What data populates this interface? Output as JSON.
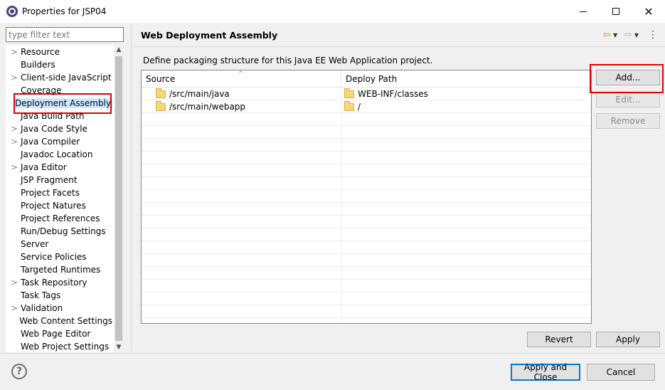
{
  "window": {
    "title": "Properties for JSP04",
    "app_icon": "eclipse-icon",
    "controls": [
      "minimize",
      "maximize",
      "close"
    ]
  },
  "filter": {
    "placeholder": "type filter text",
    "value": ""
  },
  "tree": {
    "items": [
      {
        "label": "Resource",
        "expandable": true
      },
      {
        "label": "Builders",
        "expandable": false
      },
      {
        "label": "Client-side JavaScript",
        "expandable": true
      },
      {
        "label": "Coverage",
        "expandable": false
      },
      {
        "label": "Deployment Assembly",
        "expandable": false,
        "selected": true
      },
      {
        "label": "Java Build Path",
        "expandable": false
      },
      {
        "label": "Java Code Style",
        "expandable": true
      },
      {
        "label": "Java Compiler",
        "expandable": true
      },
      {
        "label": "Javadoc Location",
        "expandable": false
      },
      {
        "label": "Java Editor",
        "expandable": true
      },
      {
        "label": "JSP Fragment",
        "expandable": false
      },
      {
        "label": "Project Facets",
        "expandable": false
      },
      {
        "label": "Project Natures",
        "expandable": false
      },
      {
        "label": "Project References",
        "expandable": false
      },
      {
        "label": "Run/Debug Settings",
        "expandable": false
      },
      {
        "label": "Server",
        "expandable": false
      },
      {
        "label": "Service Policies",
        "expandable": false
      },
      {
        "label": "Targeted Runtimes",
        "expandable": false
      },
      {
        "label": "Task Repository",
        "expandable": true
      },
      {
        "label": "Task Tags",
        "expandable": false
      },
      {
        "label": "Validation",
        "expandable": true
      },
      {
        "label": "Web Content Settings",
        "expandable": false
      },
      {
        "label": "Web Page Editor",
        "expandable": false
      },
      {
        "label": "Web Project Settings",
        "expandable": false
      }
    ]
  },
  "page": {
    "title": "Web Deployment Assembly",
    "description": "Define packaging structure for this Java EE Web Application project.",
    "nav_icons": [
      "back-arrow-icon",
      "forward-arrow-icon",
      "view-menu-icon"
    ]
  },
  "table": {
    "columns": [
      "Source",
      "Deploy Path"
    ],
    "rows": [
      {
        "source": "/src/main/java",
        "deploy_path": "WEB-INF/classes"
      },
      {
        "source": "/src/main/webapp",
        "deploy_path": "/"
      }
    ]
  },
  "side_buttons": {
    "add": "Add...",
    "edit": "Edit...",
    "remove": "Remove"
  },
  "page_buttons": {
    "revert": "Revert",
    "apply": "Apply"
  },
  "dialog_buttons": {
    "apply_and_close": "Apply and Close",
    "cancel": "Cancel"
  },
  "colors": {
    "highlight_box": "#e00000",
    "selection_bg": "#cce8ff",
    "default_button_border": "#0078d7"
  }
}
